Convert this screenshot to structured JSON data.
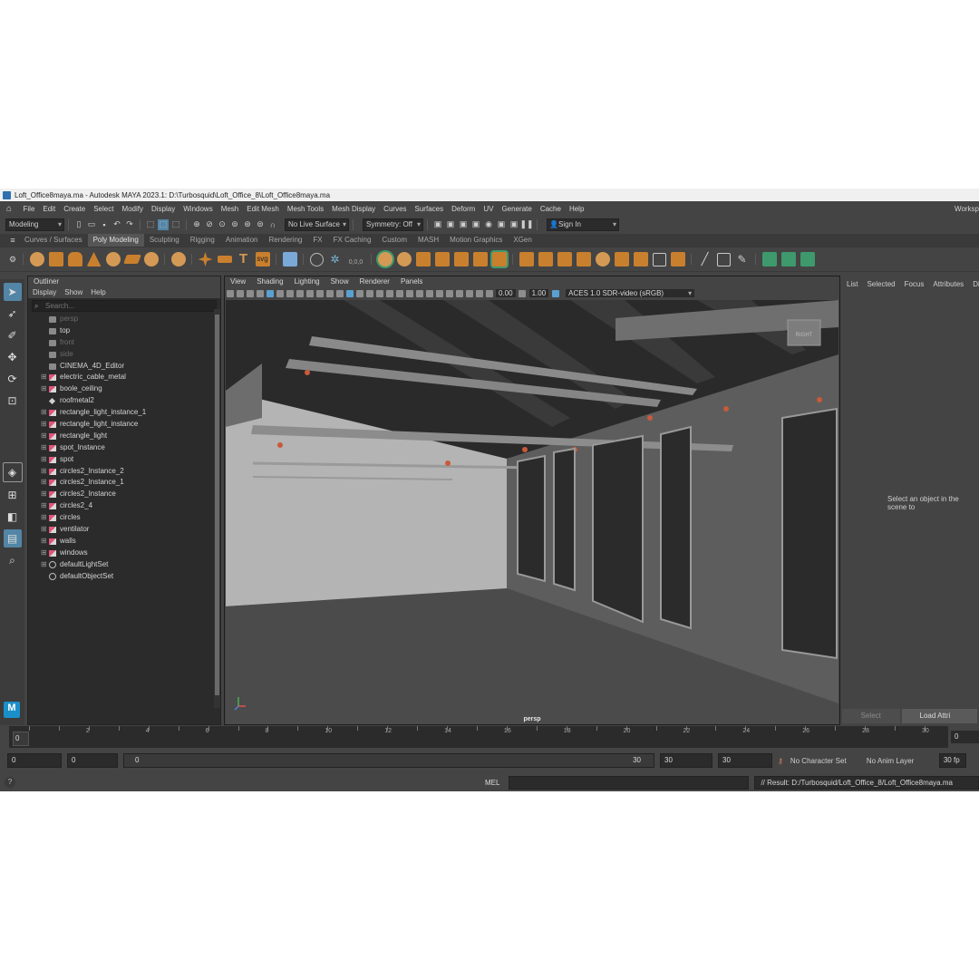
{
  "window": {
    "title": "Loft_Office8maya.ma - Autodesk MAYA 2023.1: D:\\Turbosquid\\Loft_Office_8\\Loft_Office8maya.ma"
  },
  "menubar": {
    "items": [
      "File",
      "Edit",
      "Create",
      "Select",
      "Modify",
      "Display",
      "Windows",
      "Mesh",
      "Edit Mesh",
      "Mesh Tools",
      "Mesh Display",
      "Curves",
      "Surfaces",
      "Deform",
      "UV",
      "Generate",
      "Cache",
      "Help"
    ],
    "workspace_label": "Worksp"
  },
  "statusline": {
    "menuset": "Modeling",
    "live_surface": "No Live Surface",
    "symmetry": "Symmetry: Off",
    "sign_in": "Sign In"
  },
  "shelf": {
    "tabs": [
      "Curves / Surfaces",
      "Poly Modeling",
      "Sculpting",
      "Rigging",
      "Animation",
      "Rendering",
      "FX",
      "FX Caching",
      "Custom",
      "MASH",
      "Motion Graphics",
      "XGen"
    ],
    "active_tab": "Poly Modeling",
    "svg_label": "svg",
    "text_label": "T",
    "coord_label": "0,0,0"
  },
  "outliner": {
    "title": "Outliner",
    "menu": [
      "Display",
      "Show",
      "Help"
    ],
    "search_placeholder": "Search...",
    "items": [
      {
        "label": "persp",
        "type": "camera",
        "dim": true,
        "expandable": false
      },
      {
        "label": "top",
        "type": "camera",
        "dim": false,
        "expandable": false
      },
      {
        "label": "front",
        "type": "camera",
        "dim": true,
        "expandable": false
      },
      {
        "label": "side",
        "type": "camera",
        "dim": true,
        "expandable": false
      },
      {
        "label": "CINEMA_4D_Editor",
        "type": "camera",
        "dim": false,
        "expandable": false
      },
      {
        "label": "electric_cable_metal",
        "type": "mesh",
        "dim": false,
        "expandable": true
      },
      {
        "label": "boole_ceiling",
        "type": "mesh",
        "dim": false,
        "expandable": true
      },
      {
        "label": "roofmetal2",
        "type": "group",
        "dim": false,
        "expandable": false
      },
      {
        "label": "rectangle_light_instance_1",
        "type": "mesh",
        "dim": false,
        "expandable": true
      },
      {
        "label": "rectangle_light_instance",
        "type": "mesh",
        "dim": false,
        "expandable": true
      },
      {
        "label": "rectangle_light",
        "type": "mesh",
        "dim": false,
        "expandable": true
      },
      {
        "label": "spot_Instance",
        "type": "mesh",
        "dim": false,
        "expandable": true
      },
      {
        "label": "spot",
        "type": "mesh",
        "dim": false,
        "expandable": true
      },
      {
        "label": "circles2_Instance_2",
        "type": "mesh",
        "dim": false,
        "expandable": true
      },
      {
        "label": "circles2_Instance_1",
        "type": "mesh",
        "dim": false,
        "expandable": true
      },
      {
        "label": "circles2_Instance",
        "type": "mesh",
        "dim": false,
        "expandable": true
      },
      {
        "label": "circles2_4",
        "type": "mesh",
        "dim": false,
        "expandable": true
      },
      {
        "label": "circles",
        "type": "mesh",
        "dim": false,
        "expandable": true
      },
      {
        "label": "ventilator",
        "type": "mesh",
        "dim": false,
        "expandable": true
      },
      {
        "label": "walls",
        "type": "mesh",
        "dim": false,
        "expandable": true
      },
      {
        "label": "windows",
        "type": "mesh",
        "dim": false,
        "expandable": true
      },
      {
        "label": "defaultLightSet",
        "type": "set",
        "dim": false,
        "expandable": true
      },
      {
        "label": "defaultObjectSet",
        "type": "set",
        "dim": false,
        "expandable": false
      }
    ]
  },
  "viewport": {
    "menu": [
      "View",
      "Shading",
      "Lighting",
      "Show",
      "Renderer",
      "Panels"
    ],
    "exposure": "0.00",
    "gamma": "1.00",
    "color_space": "ACES 1.0 SDR-video (sRGB)",
    "camera_label": "persp",
    "viewcube_label": "RIGHT"
  },
  "attribute_panel": {
    "tabs": [
      "List",
      "Selected",
      "Focus",
      "Attributes",
      "Displ"
    ],
    "empty_message": "Select an object in the scene to",
    "select_button": "Select",
    "load_button": "Load Attri"
  },
  "timeline": {
    "ticks": [
      "0",
      "1",
      "2",
      "3",
      "4",
      "5",
      "6",
      "7",
      "8",
      "9",
      "10",
      "11",
      "12",
      "13",
      "14",
      "15",
      "16",
      "17",
      "18",
      "19",
      "20",
      "21",
      "22",
      "23",
      "24",
      "25",
      "26",
      "27",
      "28",
      "29",
      "30"
    ],
    "labeled": [
      "2",
      "4",
      "6",
      "8",
      "10",
      "12",
      "14",
      "16",
      "18",
      "20",
      "22",
      "24",
      "26",
      "28",
      "30"
    ],
    "current_frame": "0",
    "current_frame_right": "0"
  },
  "range": {
    "start": "0",
    "inner_start": "0",
    "slider_start": "0",
    "slider_end": "30",
    "inner_end": "30",
    "end": "30",
    "character_set": "No Character Set",
    "anim_layer": "No Anim Layer",
    "fps": "30 fp"
  },
  "commandline": {
    "mel_label": "MEL",
    "result": "// Result: D:/Turbosquid/Loft_Office_8/Loft_Office8maya.ma"
  },
  "logo": {
    "text": "M"
  }
}
